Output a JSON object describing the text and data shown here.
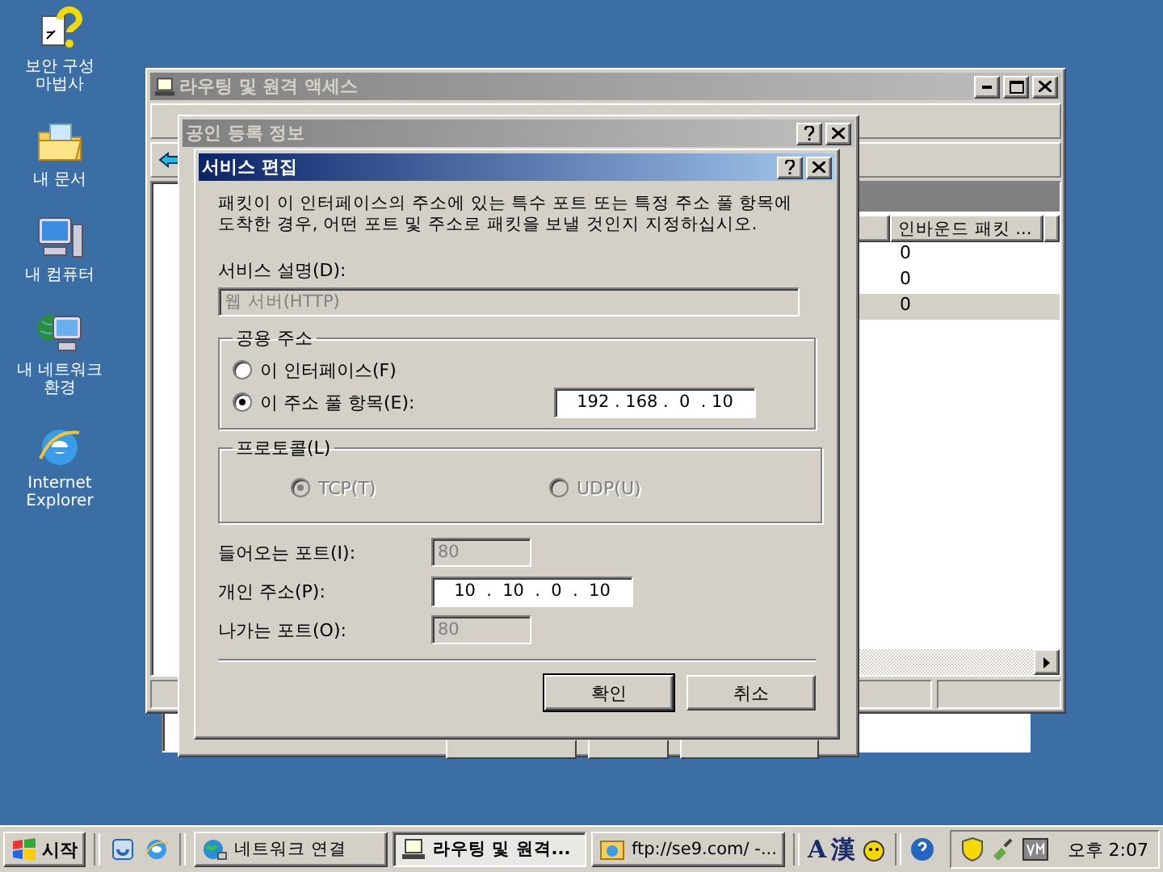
{
  "desktop_icons": [
    {
      "kind": "wizard",
      "label": "보안 구성 마법사"
    },
    {
      "kind": "documents",
      "label": "내 문서"
    },
    {
      "kind": "computer",
      "label": "내 컴퓨터"
    },
    {
      "kind": "network",
      "label": "내 네트워크 환경"
    },
    {
      "kind": "browser",
      "label": "Internet Explorer"
    }
  ],
  "main_window": {
    "title": "라우팅 및 원격 액세스",
    "active": false,
    "column_header": "인바운드 패킷 ...",
    "rows": [
      {
        "value": "0",
        "selected": false
      },
      {
        "value": "0",
        "selected": false
      },
      {
        "value": "0",
        "selected": true
      }
    ]
  },
  "properties_dialog": {
    "title": "공인 등록 정보",
    "active": false
  },
  "edit_dialog": {
    "title": "서비스 편집",
    "active": true,
    "description": "패킷이 이 인터페이스의 주소에 있는 특수 포트 또는 특정 주소 풀 항목에 도착한 경우, 어떤 포트 및 주소로 패킷을 보낼 것인지 지정하십시오.",
    "service_label": "서비스 설명(D):",
    "service_value": "웹 서버(HTTP)",
    "service_disabled": true,
    "public_address": {
      "title": "공용 주소",
      "options": [
        {
          "label": "이 인터페이스(F)",
          "selected": false
        },
        {
          "label": "이 주소 풀 항목(E):",
          "selected": true
        }
      ],
      "ip": "192 . 168 .  0  . 10"
    },
    "protocol": {
      "title": "프로토콜(L)",
      "disabled": true,
      "options": [
        {
          "label": "TCP(T)",
          "selected": true
        },
        {
          "label": "UDP(U)",
          "selected": false
        }
      ]
    },
    "fields": [
      {
        "kind": "port",
        "label": "들어오는 포트(I):",
        "value": "80",
        "disabled": true
      },
      {
        "kind": "ip",
        "label": "개인 주소(P):",
        "value": "10  .  10  .  0  .  10"
      },
      {
        "kind": "port",
        "label": "나가는 포트(O):",
        "value": "80",
        "disabled": true
      }
    ],
    "buttons": [
      {
        "label": "확인",
        "default": true
      },
      {
        "label": "취소",
        "default": false
      }
    ]
  },
  "taskbar": {
    "start": "시작",
    "tasks": [
      {
        "kind": "network",
        "label": "네트워크 연결",
        "selected": false
      },
      {
        "kind": "routing",
        "label": "라우팅 및 원격...",
        "selected": true
      },
      {
        "kind": "ftp",
        "label": "ftp://se9.com/ -...",
        "selected": false
      }
    ],
    "tray_text": [
      "A",
      "漢"
    ],
    "clock": "오후 2:07"
  }
}
